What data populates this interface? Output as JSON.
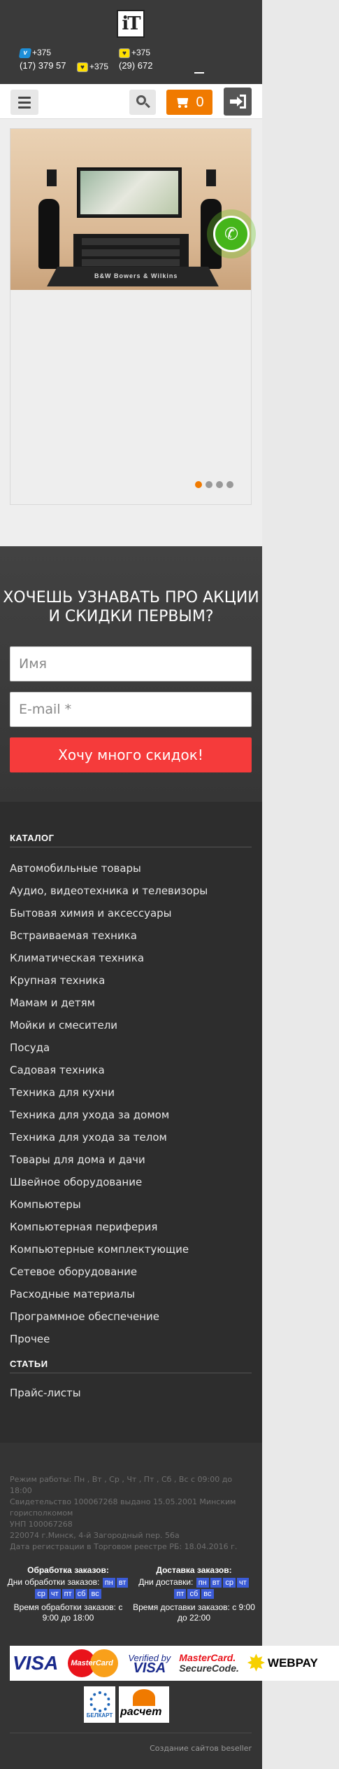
{
  "header": {
    "logo_text": "iT",
    "phones": [
      {
        "operator": "velcom",
        "code": "+375",
        "number": "(17) 379 57"
      },
      {
        "operator": "life",
        "code": "+375",
        "number": "(29) 672"
      }
    ],
    "extra_code": "+375",
    "cart_count": "0"
  },
  "slider": {
    "rug_text": "B&W  Bowers & Wilkins",
    "dots": 4,
    "active_dot": 0
  },
  "subscribe": {
    "title": "ХОЧЕШЬ УЗНАВАТЬ ПРО АКЦИИ И СКИДКИ ПЕРВЫМ?",
    "name_placeholder": "Имя",
    "email_placeholder": "E-mail *",
    "button": "Хочу много скидок!"
  },
  "catalog": {
    "title": "КАТАЛОГ",
    "items": [
      "Автомобильные товары",
      "Аудио, видеотехника и телевизоры",
      "Бытовая химия и аксессуары",
      "Встраиваемая техника",
      "Климатическая техника",
      "Крупная техника",
      "Мамам и детям",
      "Мойки и смесители",
      "Посуда",
      "Садовая техника",
      "Техника для кухни",
      "Техника для ухода за домом",
      "Техника для ухода за телом",
      "Товары для дома и дачи",
      "Швейное оборудование",
      "Компьютеры",
      "Компьютерная периферия",
      "Компьютерные комплектующие",
      "Сетевое оборудование",
      "Расходные материалы",
      "Программное обеспечение",
      "Прочее"
    ]
  },
  "articles": {
    "title": "СТАТЬИ",
    "items": [
      "Прайс-листы"
    ]
  },
  "footer": {
    "info": [
      "Режим работы: Пн , Вт , Ср , Чт , Пт , Сб , Вс с 09:00 до 18:00",
      "Свидетельство 100067268 выдано 15.05.2001 Минским горисполкомом",
      "УНП 100067268",
      "220074 г.Минск, 4-й Загородный пер. 56а",
      "Дата регистрации в Торговом реестре РБ: 18.04.2016 г."
    ],
    "processing": {
      "title": "Обработка заказов:",
      "days_label": "Дни обработки заказов:",
      "days": [
        "пн",
        "вт",
        "ср",
        "чт",
        "пт",
        "сб",
        "вс"
      ],
      "time": "Время обработки заказов: с 9:00 до 18:00"
    },
    "delivery": {
      "title": "Доставка заказов:",
      "days_label": "Дни доставки:",
      "days": [
        "пн",
        "вт",
        "ср",
        "чт",
        "пт",
        "сб",
        "вс"
      ],
      "time": "Время доставки заказов: с 9:00 до 22:00"
    },
    "payment_logos": [
      "VISA",
      "MasterCard",
      "Verified by VISA",
      "MasterCard. SecureCode.",
      "WEBPAY",
      "БЕЛКАРТ",
      "расчет"
    ],
    "copyright": "Создание сайтов beseller"
  }
}
